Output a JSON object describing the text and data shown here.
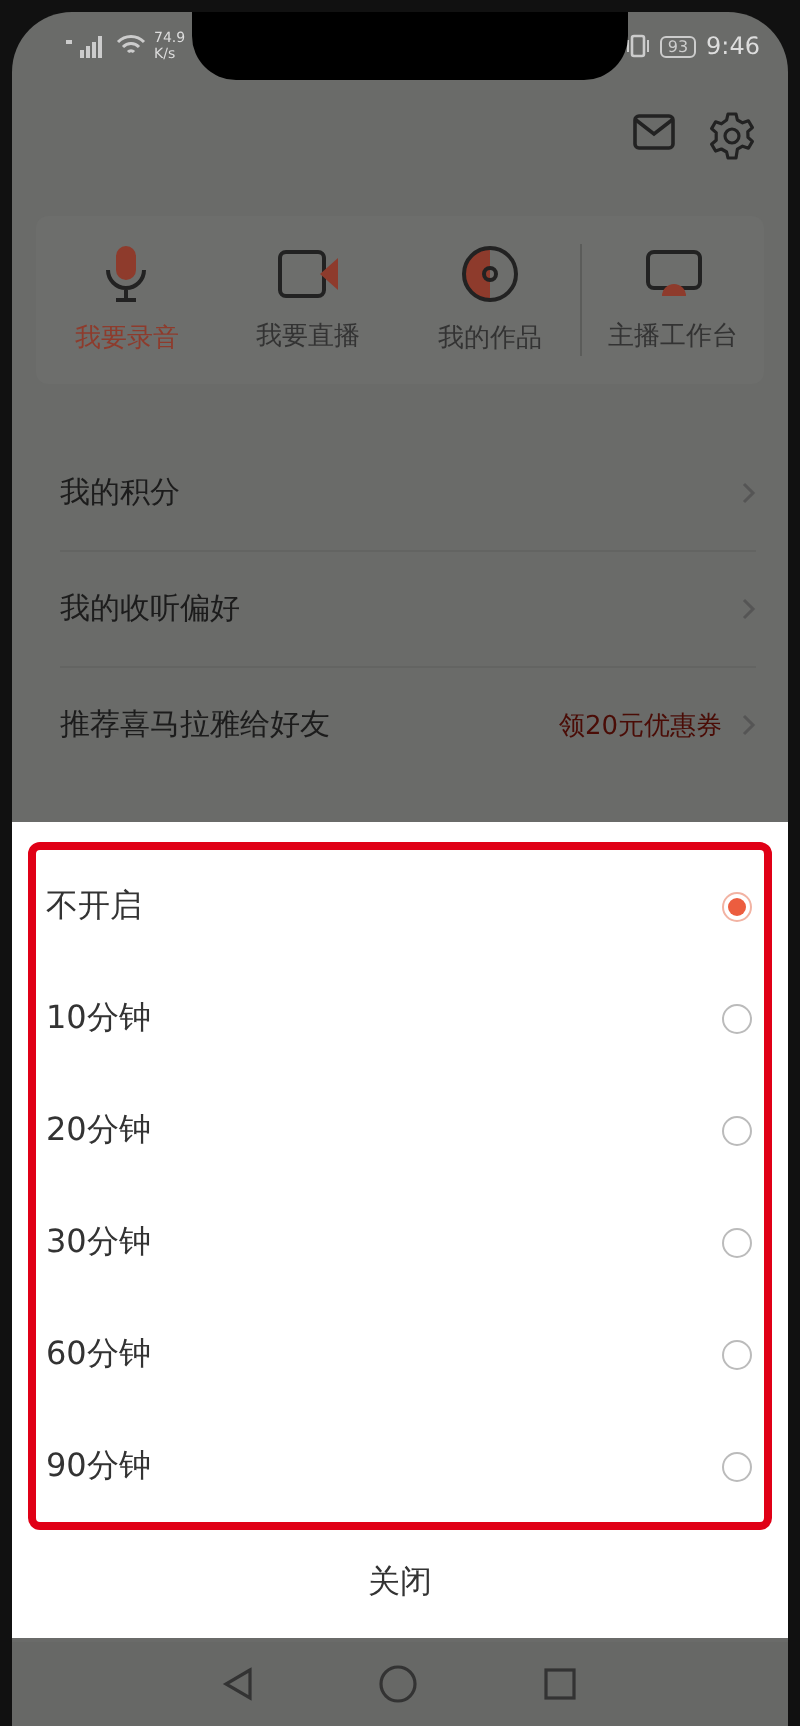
{
  "status_bar": {
    "net_speed": "74.9",
    "net_unit": "K/s",
    "battery": "93",
    "time": "9:46"
  },
  "shortcuts": [
    {
      "label": "我要录音",
      "kind": "mic",
      "selected": true
    },
    {
      "label": "我要直播",
      "kind": "video",
      "selected": false
    },
    {
      "label": "我的作品",
      "kind": "disc",
      "selected": false
    },
    {
      "label": "主播工作台",
      "kind": "monitor",
      "selected": false
    }
  ],
  "menu": [
    {
      "label": "我的积分"
    },
    {
      "label": "我的收听偏好"
    },
    {
      "label": "推荐喜马拉雅给好友",
      "badge": "领20元优惠券"
    }
  ],
  "sheet": {
    "options": [
      {
        "label": "不开启",
        "selected": true
      },
      {
        "label": "10分钟",
        "selected": false
      },
      {
        "label": "20分钟",
        "selected": false
      },
      {
        "label": "30分钟",
        "selected": false
      },
      {
        "label": "60分钟",
        "selected": false
      },
      {
        "label": "90分钟",
        "selected": false
      }
    ],
    "close_label": "关闭"
  }
}
